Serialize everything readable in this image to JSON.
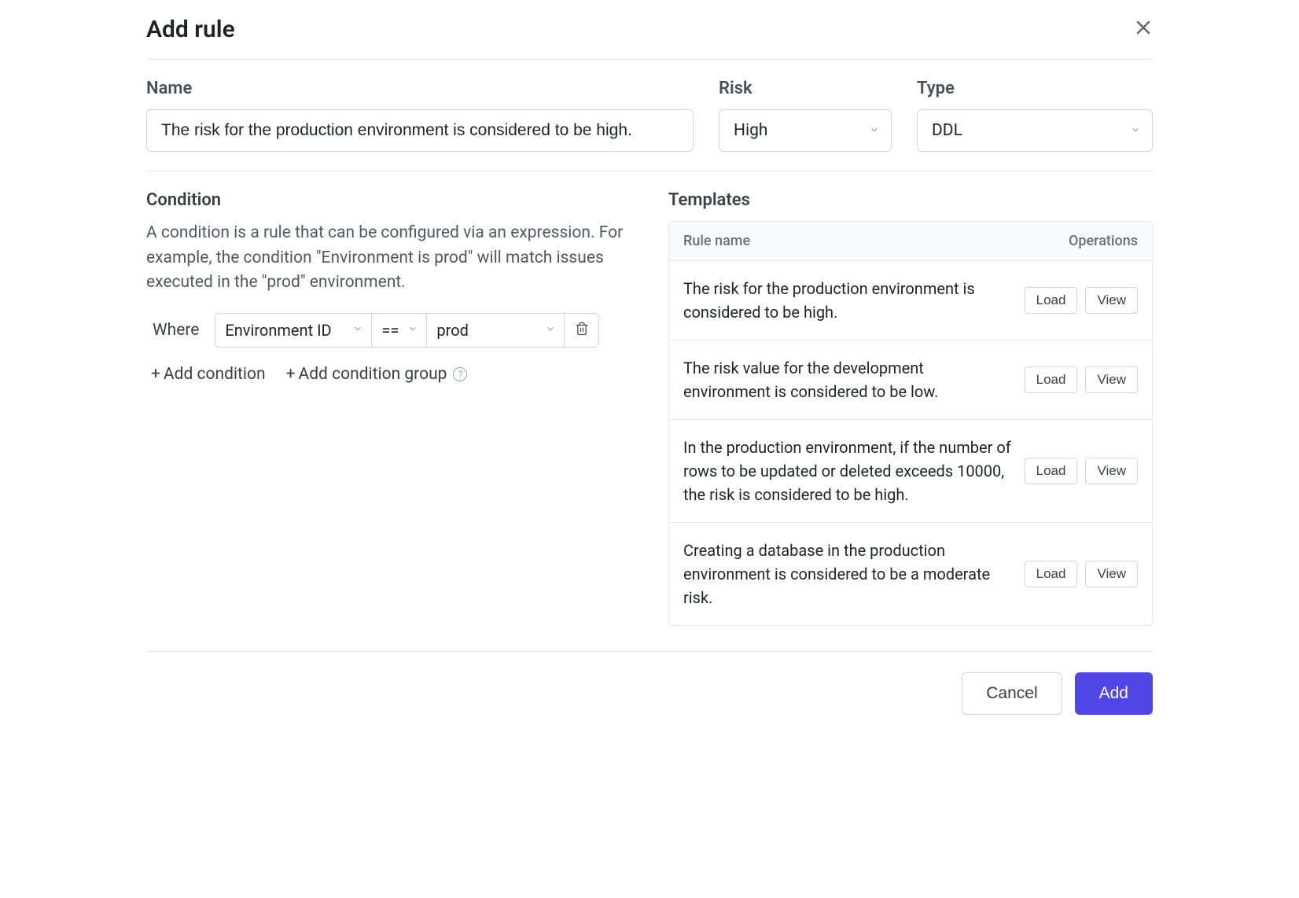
{
  "dialog": {
    "title": "Add rule"
  },
  "fields": {
    "name": {
      "label": "Name",
      "value": "The risk for the production environment is considered to be high."
    },
    "risk": {
      "label": "Risk",
      "value": "High"
    },
    "type": {
      "label": "Type",
      "value": "DDL"
    }
  },
  "condition": {
    "title": "Condition",
    "description": "A condition is a rule that can be configured via an expression. For example, the condition \"Environment is prod\" will match issues executed in the \"prod\" environment.",
    "where_label": "Where",
    "field": "Environment ID",
    "operator": "==",
    "value": "prod",
    "add_condition": "Add condition",
    "add_group": "Add condition group"
  },
  "templates": {
    "title": "Templates",
    "columns": {
      "rule": "Rule name",
      "ops": "Operations"
    },
    "load_label": "Load",
    "view_label": "View",
    "rows": [
      {
        "name": "The risk for the production environment is considered to be high."
      },
      {
        "name": "The risk value for the development environment is considered to be low."
      },
      {
        "name": "In the production environment, if the number of rows to be updated or deleted exceeds 10000, the risk is considered to be high."
      },
      {
        "name": "Creating a database in the production environment is considered to be a moderate risk."
      }
    ]
  },
  "footer": {
    "cancel": "Cancel",
    "add": "Add"
  }
}
